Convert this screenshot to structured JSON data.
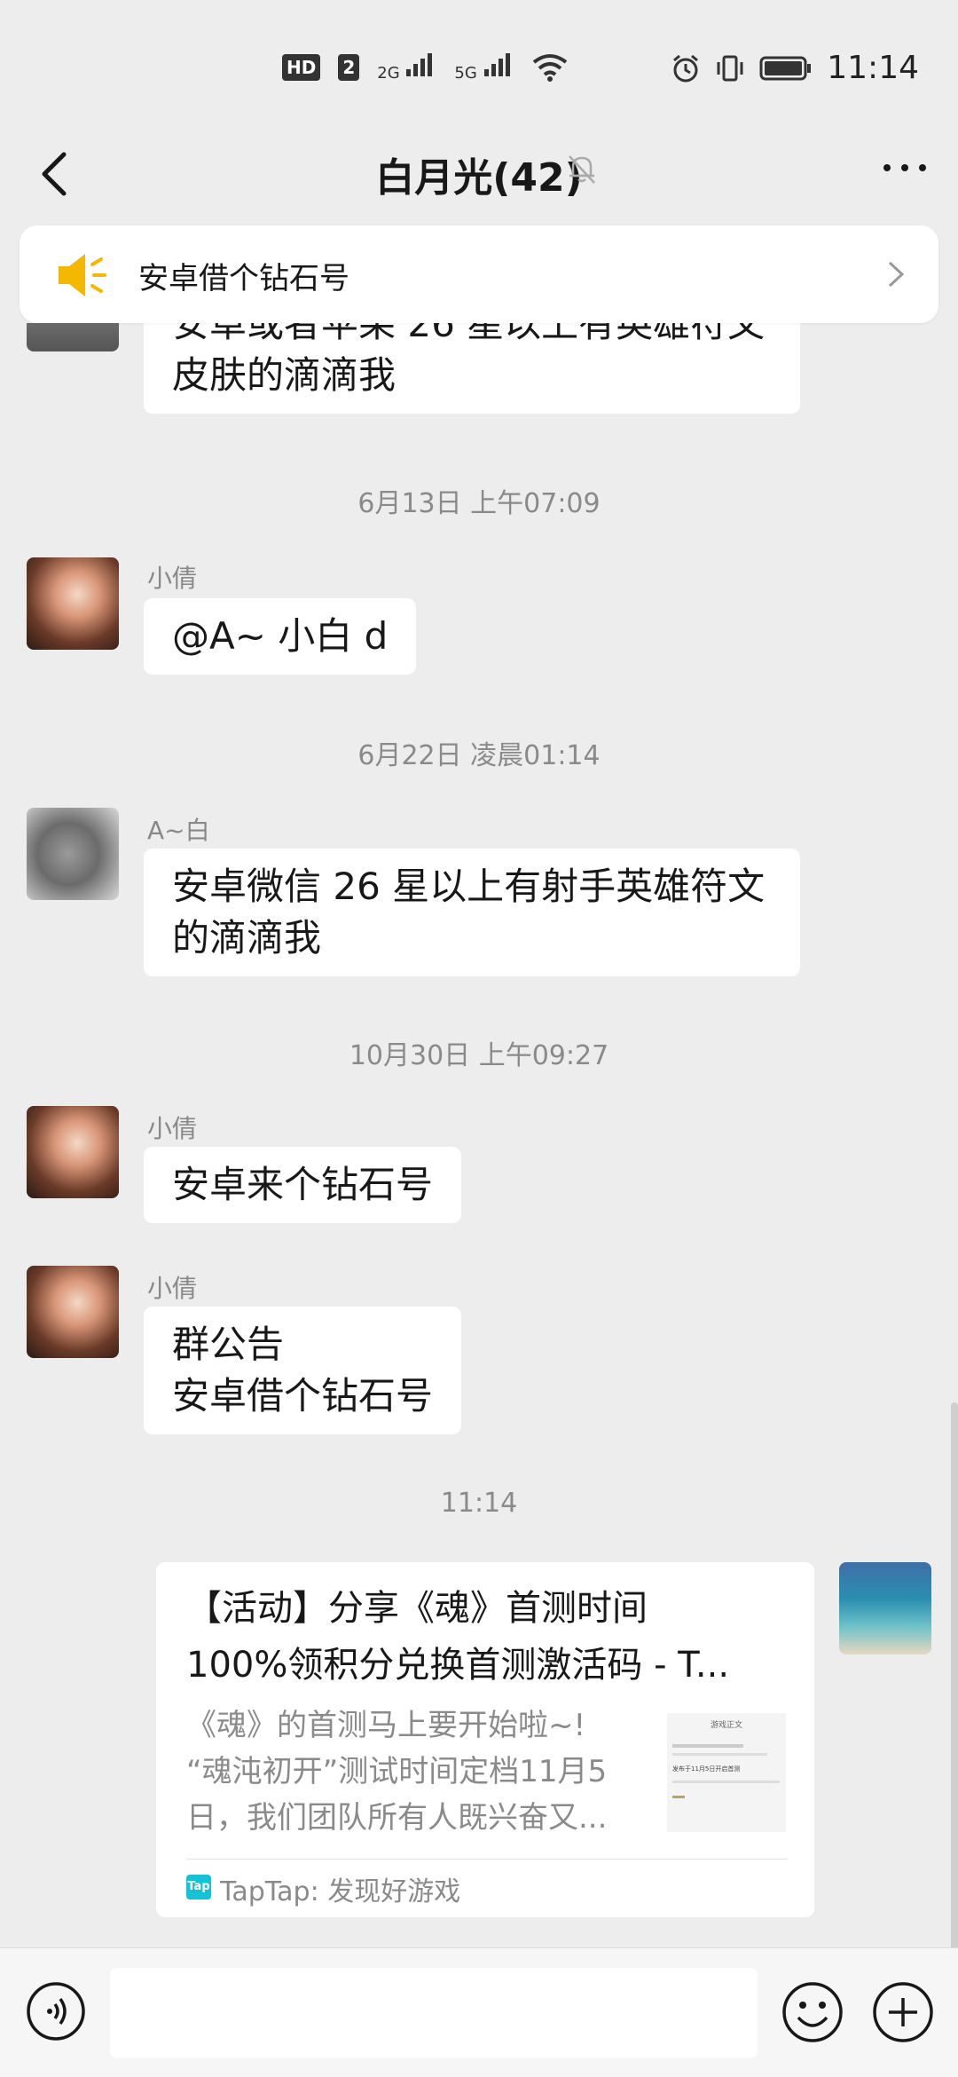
{
  "status_bar": {
    "network_badge": "HD",
    "sim_badge": "2",
    "signal_1": "2G",
    "signal_2": "5G",
    "clock": "11:14"
  },
  "header": {
    "title": "白月光(42)"
  },
  "notice": {
    "text": "安卓借个钻石号"
  },
  "messages": [
    {
      "type": "bubble_partial",
      "line1": "安卓或者苹果 26 星以上有英雄符文",
      "line2": "皮肤的滴滴我"
    },
    {
      "type": "time",
      "text": "6月13日 上午07:09"
    },
    {
      "type": "bubble",
      "sender": "小倩",
      "text": "@A~ 小白  d"
    },
    {
      "type": "time",
      "text": "6月22日 凌晨01:14"
    },
    {
      "type": "bubble",
      "sender": "A~白",
      "line1": "安卓微信 26 星以上有射手英雄符文",
      "line2": "的滴滴我"
    },
    {
      "type": "time",
      "text": "10月30日 上午09:27"
    },
    {
      "type": "bubble",
      "sender": "小倩",
      "text": "安卓来个钻石号"
    },
    {
      "type": "bubble",
      "sender": "小倩",
      "line1": "群公告",
      "line2": "安卓借个钻石号"
    },
    {
      "type": "time",
      "text": "11:14"
    }
  ],
  "link_card": {
    "title_line1": "【活动】分享《魂》首测时间",
    "title_line2": "100%领积分兑换首测激活码 - T...",
    "desc_line1": "《魂》的首测马上要开始啦~!",
    "desc_line2": "“魂沌初开”测试时间定档11月5",
    "desc_line3": "日，我们团队所有人既兴奋又...",
    "thumb_title": "游戏正文",
    "thumb_caption": "发布于11月5日开启首测",
    "source_icon": "Tap",
    "source": "TapTap: 发现好游戏"
  },
  "colors": {
    "background": "#ededed",
    "bubble": "#ffffff",
    "accent_speaker": "#f5b800",
    "taptap": "#14c2d6"
  },
  "icons": [
    "back-arrow-icon",
    "mute-bell-icon",
    "more-icon",
    "speaker-icon",
    "chevron-right-icon",
    "voice-icon",
    "emoji-icon",
    "plus-icon"
  ]
}
